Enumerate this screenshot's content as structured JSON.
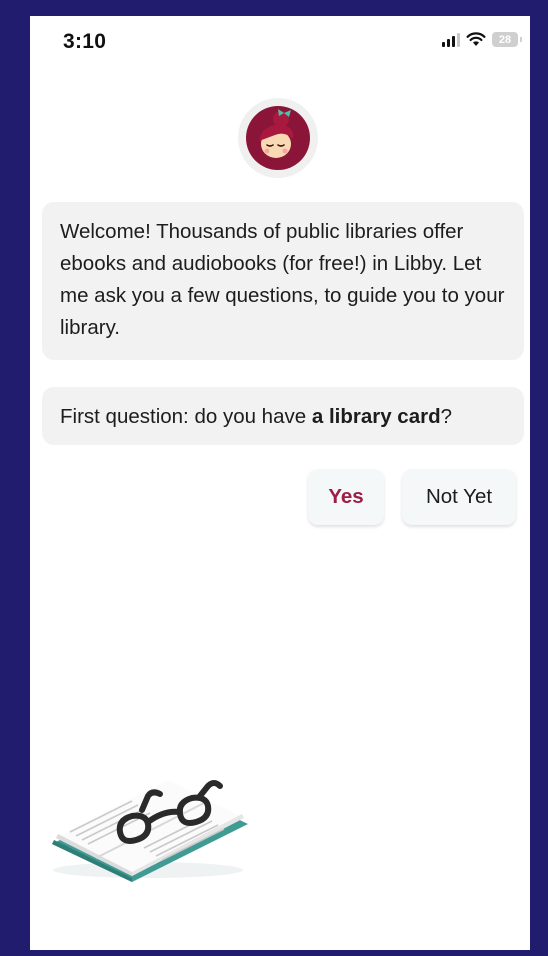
{
  "status_bar": {
    "time": "3:10",
    "battery_level": "28",
    "icons": [
      "cellular-signal-icon",
      "wifi-icon",
      "battery-icon"
    ]
  },
  "assistant": {
    "avatar_icon": "libby-avatar-icon"
  },
  "messages": {
    "welcome": "Welcome! Thousands of public libraries offer ebooks and audiobooks (for free!) in Libby. Let me ask you a few questions, to guide you to your library.",
    "question_prefix": "First question: do you have ",
    "question_bold": "a library card",
    "question_suffix": "?"
  },
  "answers": {
    "yes_label": "Yes",
    "not_yet_label": "Not Yet"
  },
  "illustration": {
    "icon": "open-book-with-glasses-icon"
  },
  "colors": {
    "frame": "#211c6e",
    "accent": "#9c1f45",
    "bubble": "#f2f2f2",
    "book_teal": "#3f9b94"
  }
}
